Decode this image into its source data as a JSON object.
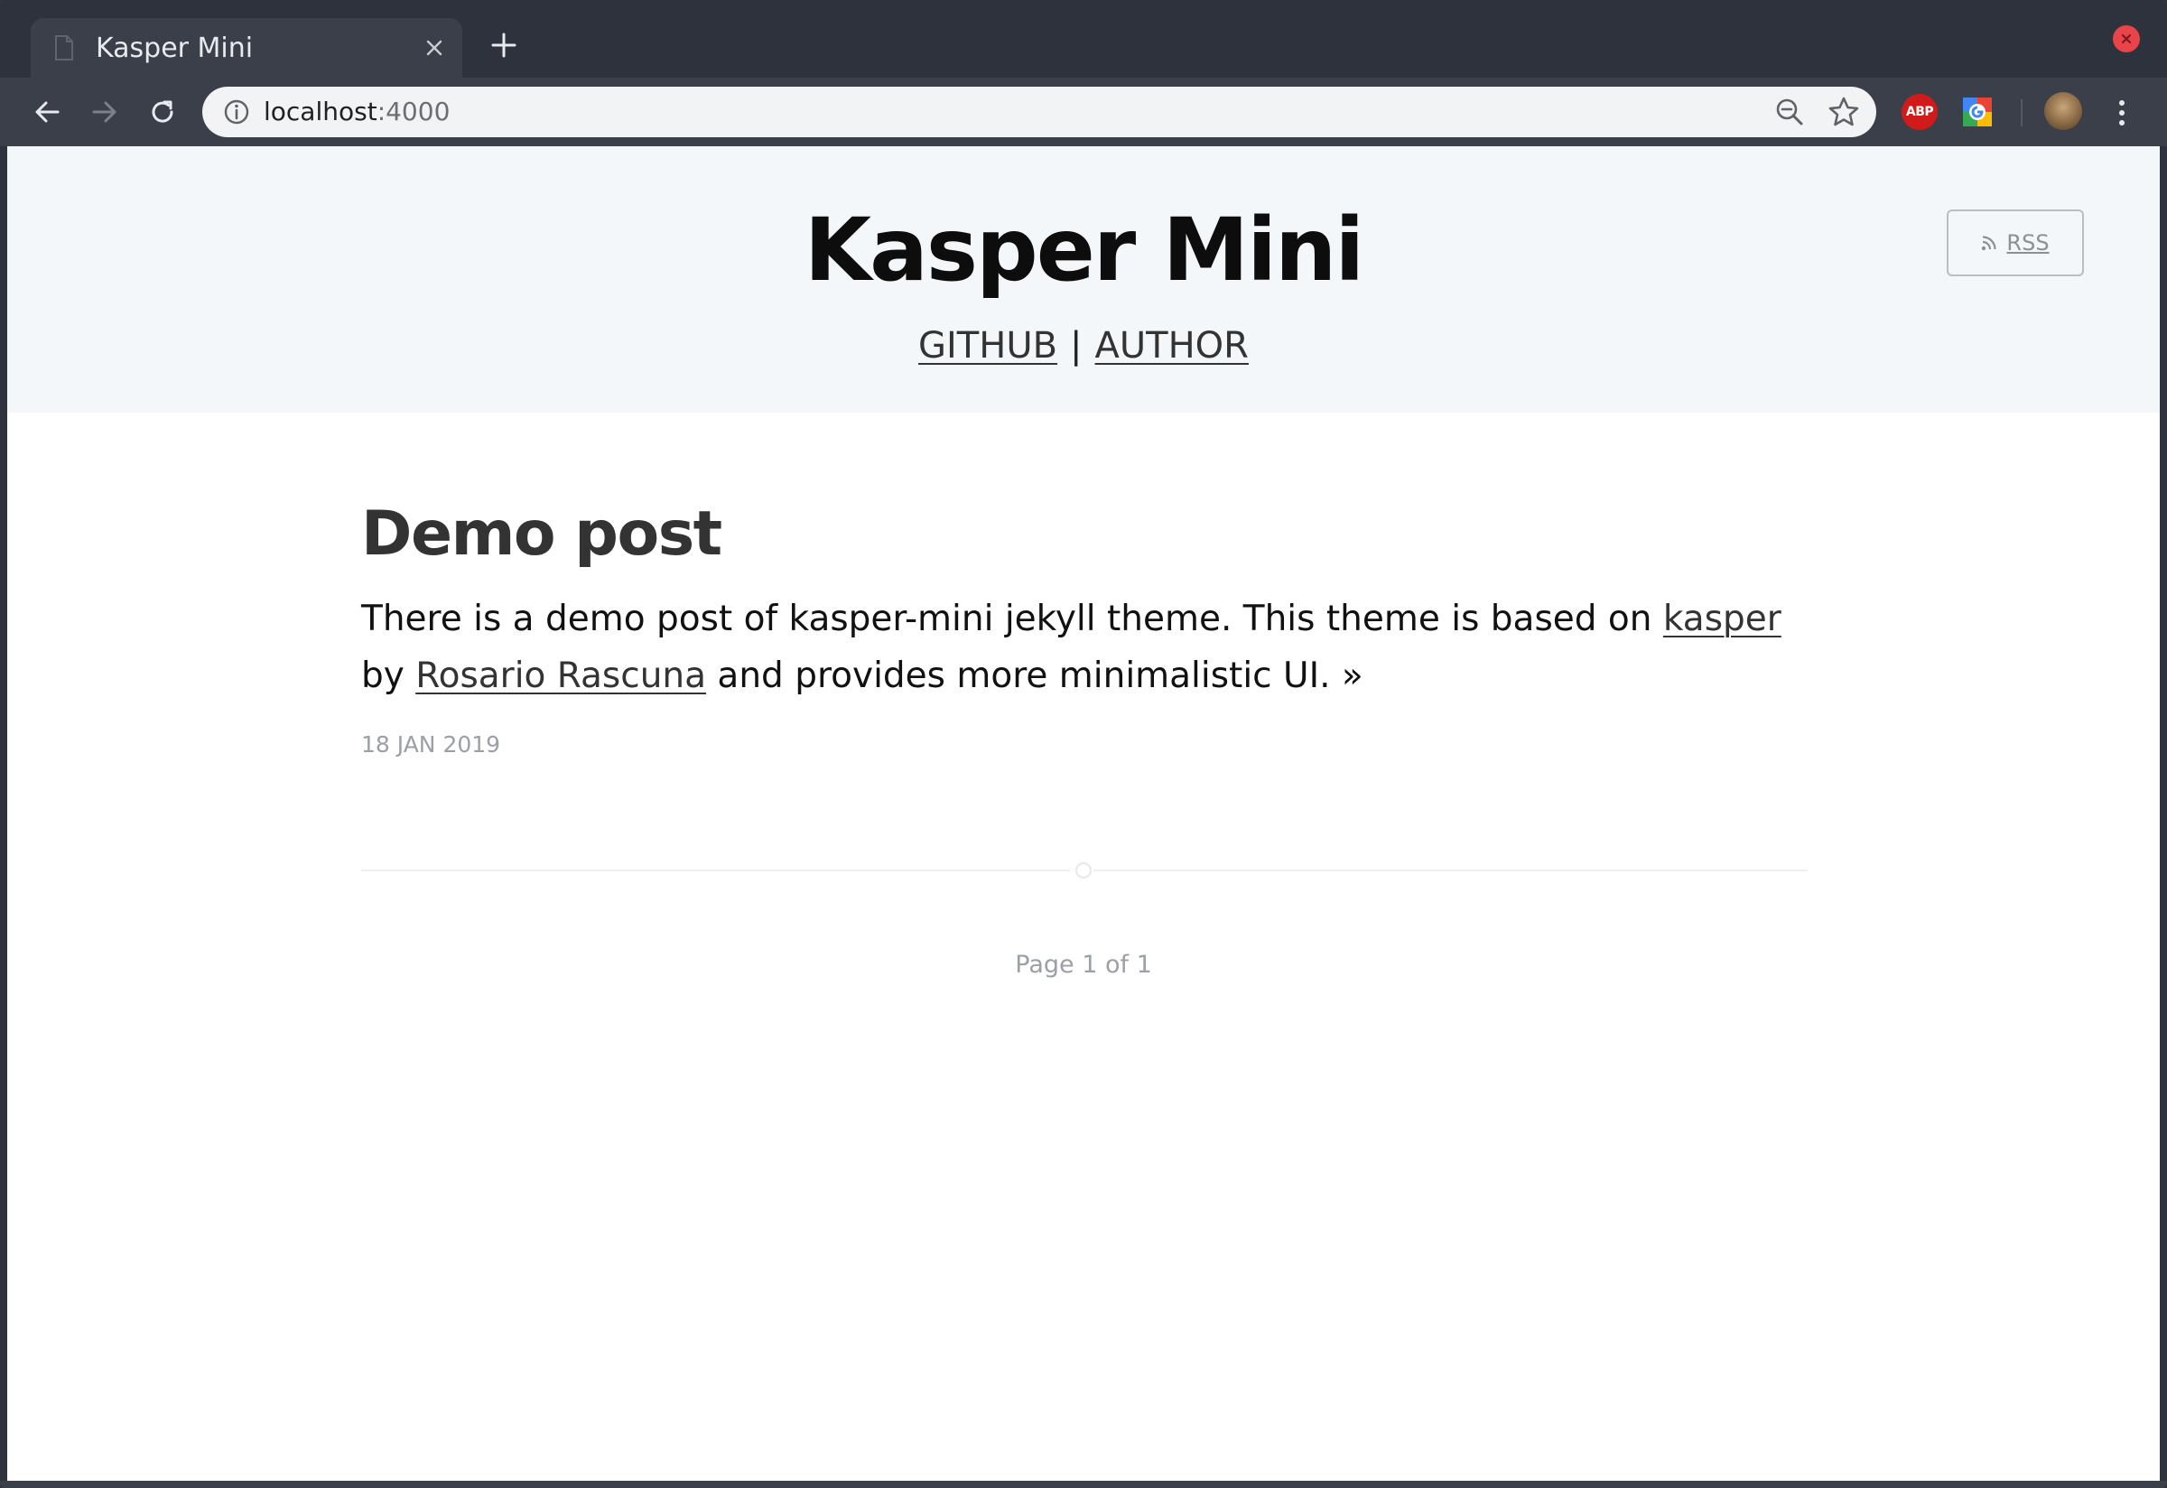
{
  "browser": {
    "tab": {
      "title": "Kasper Mini"
    },
    "address_bar": {
      "host": "localhost",
      "port": ":4000"
    },
    "extensions": {
      "abp_label": "ABP"
    },
    "colors": {
      "frame": "#2e323c",
      "toolbar": "#3b3f4a",
      "close": "#e8444a"
    }
  },
  "site": {
    "title": "Kasper Mini",
    "nav": {
      "github": "GITHUB",
      "separator": "|",
      "author": "AUTHOR"
    },
    "rss_label": "RSS"
  },
  "post": {
    "title": "Demo post",
    "excerpt_text_1": "There is a demo post of kasper-mini jekyll theme. This theme is based on ",
    "excerpt_link_1": "kasper",
    "excerpt_text_2": " by ",
    "excerpt_link_2": "Rosario Rascuna",
    "excerpt_text_3": " and provides more minimalistic UI. »",
    "date": "18 JAN 2019"
  },
  "pagination": {
    "label": "Page 1 of 1"
  }
}
